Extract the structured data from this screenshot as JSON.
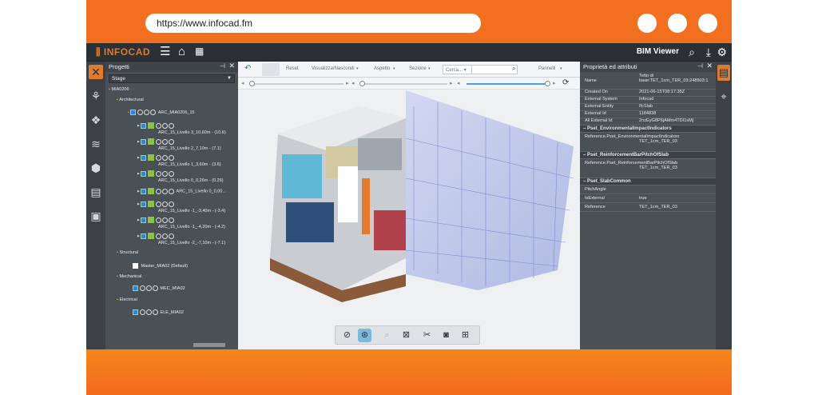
{
  "browser": {
    "url": "https://www.infocad.fm"
  },
  "app": {
    "logo": "INFOCAD",
    "title": "BIM Viewer"
  },
  "left_panel": {
    "title": "Progetti",
    "select_value": "Stage",
    "tree": [
      {
        "label": "MIA0206"
      },
      {
        "label": "Architectural"
      },
      {
        "label": "ARC_MIA0206_15"
      },
      {
        "label": "ARC_15_Livello 3_10,60m - (10.6)"
      },
      {
        "label": "ARC_15_Livello 2_7,10m - (7.1)"
      },
      {
        "label": "ARC_15_Livello 1_3,60m - (3.6)"
      },
      {
        "label": "ARC_15_Livello 0_0,26m - (0.26)"
      },
      {
        "label": "ARC_15_Livello 0_0,00..."
      },
      {
        "label": "ARC_15_Livello -1_-3,40m - (-3.4)"
      },
      {
        "label": "ARC_15_Livello -1_-4,20m - (-4.2)"
      },
      {
        "label": "ARC_15_Livello -2_-7,10m - (-7.1)"
      },
      {
        "label": "Structural"
      },
      {
        "label": "Master_MIA02 (Default)"
      },
      {
        "label": "Mechanical"
      },
      {
        "label": "MEC_MIA02"
      },
      {
        "label": "Electrical"
      },
      {
        "label": "ELE_MIA02"
      }
    ]
  },
  "viewer_toolbar": {
    "reset": "Reset",
    "visibility": "Visualizza/Nascondi",
    "appearance": "Aspetto",
    "section": "Sezione",
    "search": "Cerca...",
    "panels": "Pannelli"
  },
  "right_panel": {
    "title": "Proprietà ed attributi",
    "rows": [
      {
        "k": "Name",
        "v": "Tetto di base:TET_1cm_TER_03:248503:1"
      },
      {
        "k": "Created On",
        "v": "2021-06-15T08:17:35Z"
      },
      {
        "k": "External System",
        "v": "Infocad"
      },
      {
        "k": "External Entity",
        "v": "IfcSlab"
      },
      {
        "k": "External Id",
        "v": "1184838"
      },
      {
        "k": "All External Id",
        "v": "2nzEyG8P6jAMm4TDI1sMj"
      }
    ],
    "sections": [
      {
        "title": "Pset_EnvironmentalImpactIndicators",
        "rows": [
          {
            "k": "Reference.Pset_EnvironmentalImpactIndicators",
            "v": "TET_1cm_TER_03"
          }
        ]
      },
      {
        "title": "Pset_ReinforcementBarPitchOfSlab",
        "rows": [
          {
            "k": "Reference.Pset_ReinforcementBarPitchOfSlab",
            "v": "TET_1cm_TER_03"
          }
        ]
      },
      {
        "title": "Pset_SlabCommon",
        "rows": [
          {
            "k": "PitchAngle",
            "v": ""
          },
          {
            "k": "IsExternal",
            "v": "true"
          },
          {
            "k": "Reference",
            "v": "TET_1cm_TER_03"
          }
        ]
      }
    ]
  },
  "colors": {
    "brand": "#f26f1f",
    "accent": "#e07a2f",
    "panel": "#4a5156"
  }
}
